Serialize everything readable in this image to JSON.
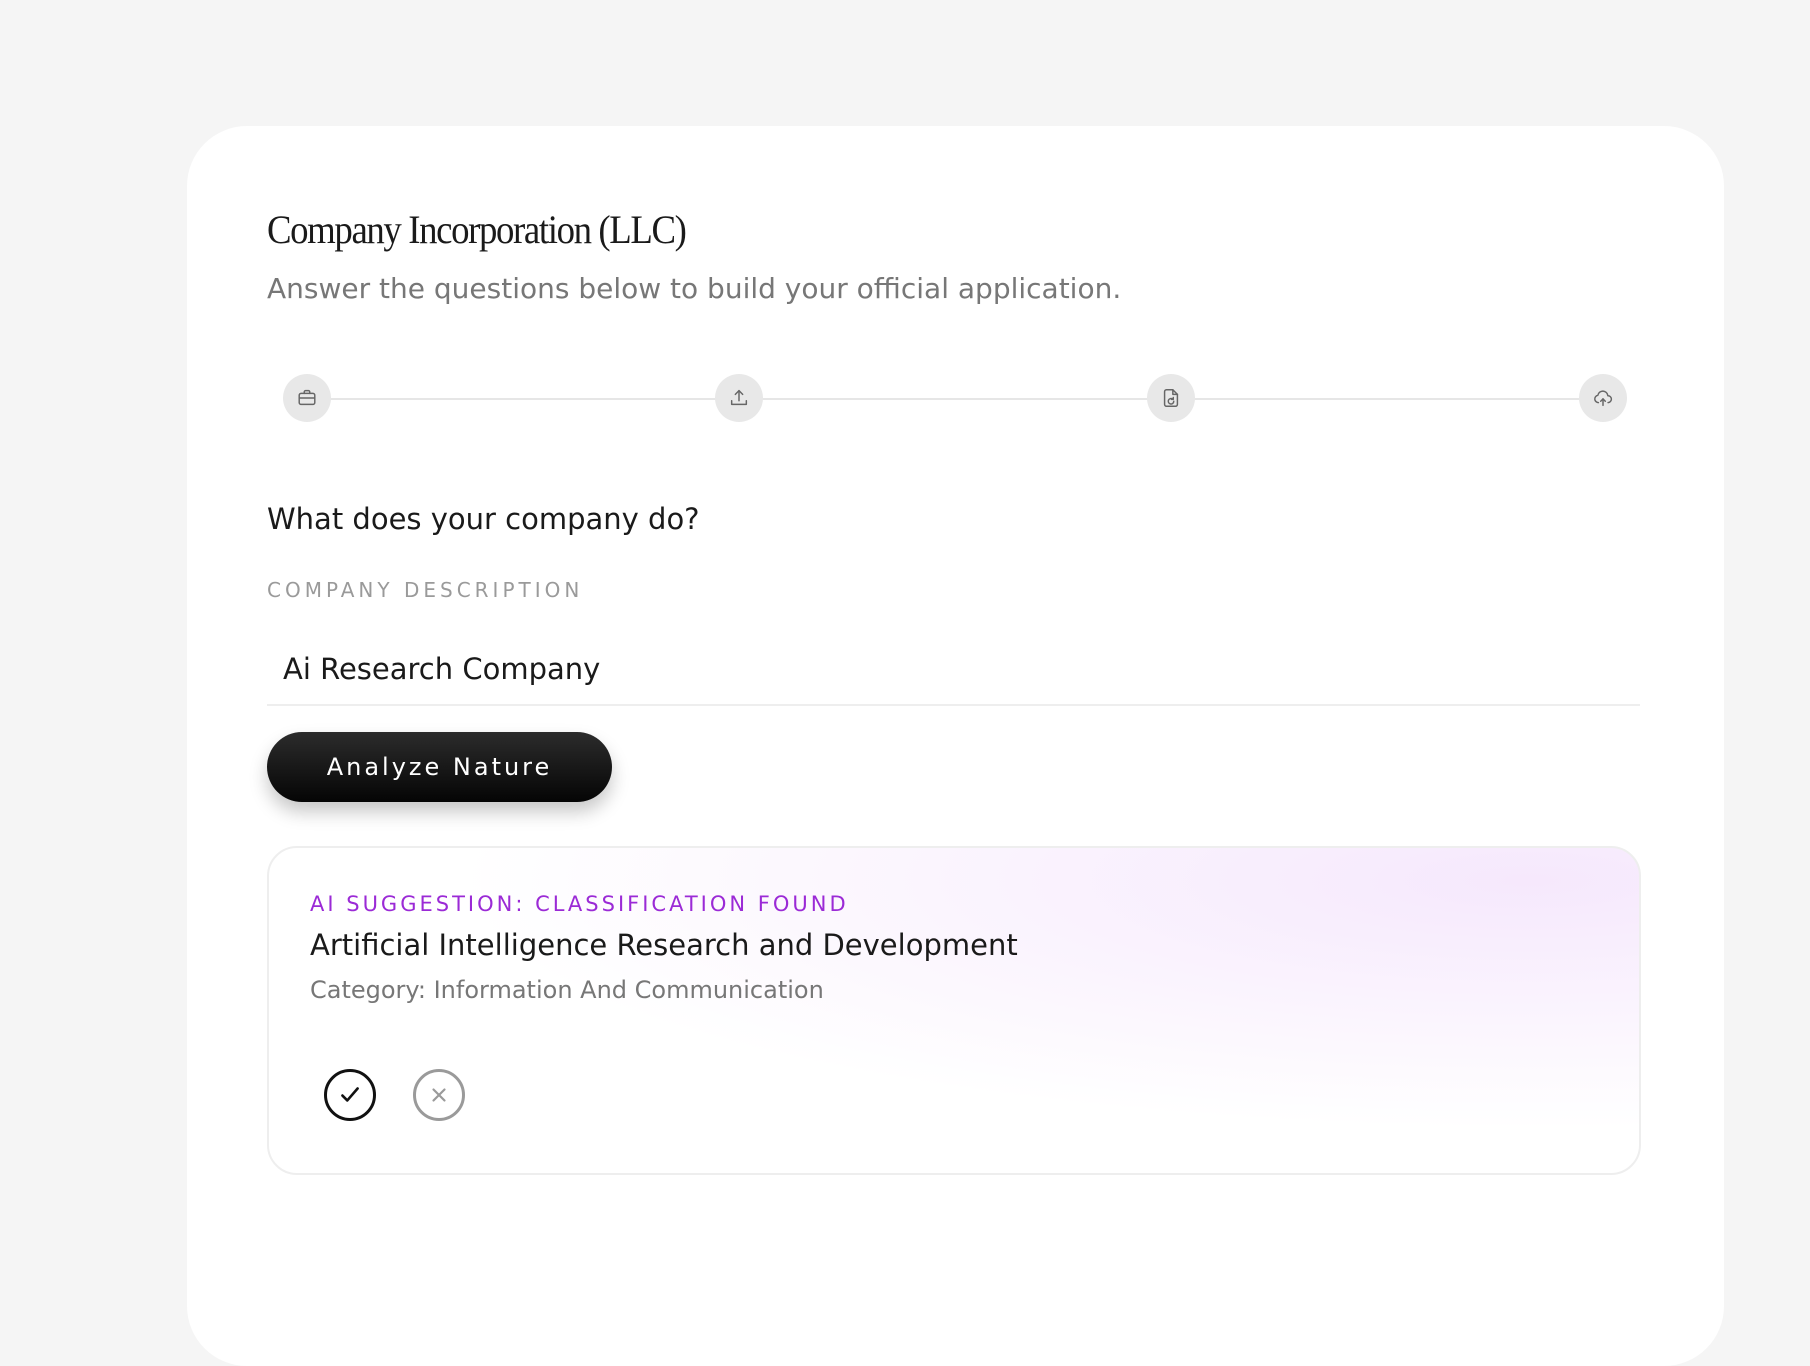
{
  "page": {
    "title": "Company Incorporation (LLC)",
    "subtitle": "Answer the questions below to build your official application."
  },
  "stepper": {
    "steps": [
      {
        "icon": "briefcase-icon"
      },
      {
        "icon": "upload-icon"
      },
      {
        "icon": "file-refresh-icon"
      },
      {
        "icon": "cloud-upload-icon"
      }
    ]
  },
  "form": {
    "question": "What does your company do?",
    "field_label": "COMPANY DESCRIPTION",
    "description_value": "Ai Research Company",
    "analyze_button": "Analyze Nature"
  },
  "suggestion": {
    "label": "AI SUGGESTION: CLASSIFICATION FOUND",
    "title": "Artificial Intelligence Research and Development",
    "category": "Category: Information And Communication",
    "accent_color": "#9b2ad6"
  }
}
